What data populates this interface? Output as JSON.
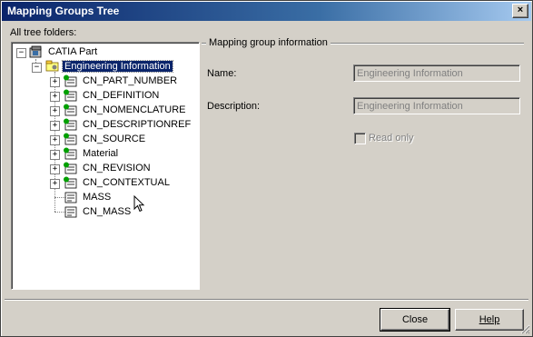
{
  "window": {
    "title": "Mapping Groups Tree"
  },
  "tree": {
    "label": "All  tree folders:",
    "root": {
      "label": "CATIA Part",
      "expander": "−"
    },
    "selected": {
      "label": "Engineering Information",
      "expander": "−"
    },
    "children": [
      {
        "label": "CN_PART_NUMBER",
        "expander": "+"
      },
      {
        "label": "CN_DEFINITION",
        "expander": "+"
      },
      {
        "label": "CN_NOMENCLATURE",
        "expander": "+"
      },
      {
        "label": "CN_DESCRIPTIONREF",
        "expander": "+"
      },
      {
        "label": "CN_SOURCE",
        "expander": "+"
      },
      {
        "label": "Material",
        "expander": "+"
      },
      {
        "label": "CN_REVISION",
        "expander": "+"
      },
      {
        "label": "CN_CONTEXTUAL",
        "expander": "+"
      },
      {
        "label": "MASS",
        "expander": ""
      },
      {
        "label": "CN_MASS",
        "expander": ""
      }
    ]
  },
  "info": {
    "group_title": "Mapping group information",
    "name_label": "Name:",
    "name_value": "Engineering Information",
    "description_label": "Description:",
    "description_value": "Engineering Information",
    "readonly_label": "Read only"
  },
  "buttons": {
    "close": "Close",
    "help": "Help"
  },
  "title_close_glyph": "×"
}
